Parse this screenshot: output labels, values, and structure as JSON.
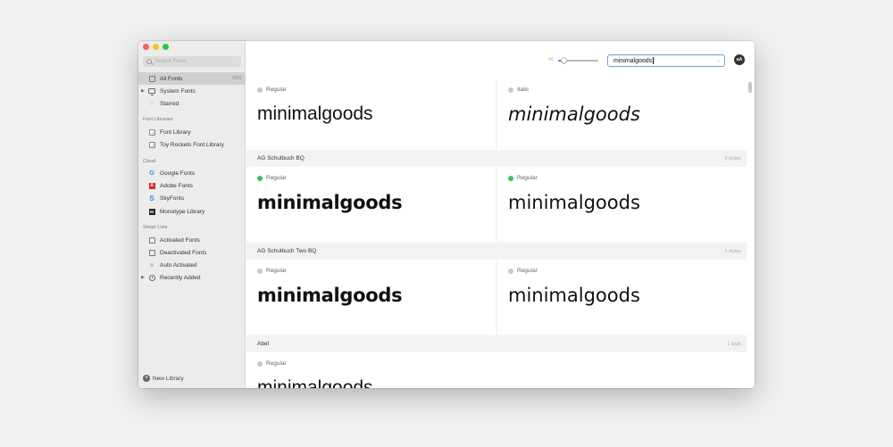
{
  "sidebar": {
    "search_placeholder": "Search Fonts",
    "top_items": [
      {
        "label": "All Fonts",
        "count": "3161",
        "icon": "font-file-icon",
        "selected": true
      },
      {
        "label": "System Fonts",
        "icon": "monitor-icon",
        "expandable": true
      },
      {
        "label": "Starred",
        "icon": "star-icon"
      }
    ],
    "sections": {
      "font_libraries": "Font Libraries",
      "cloud": "Cloud",
      "smart_lists": "Smart Lists"
    },
    "library_items": [
      {
        "label": "Font Library",
        "icon": "library-cube-icon"
      },
      {
        "label": "Toy Rockets Font Library",
        "icon": "library-cube-icon"
      }
    ],
    "cloud_items": [
      {
        "label": "Google Fonts",
        "icon": "google-icon"
      },
      {
        "label": "Adobe Fonts",
        "icon": "adobe-icon"
      },
      {
        "label": "SkyFonts",
        "icon": "skyfonts-icon"
      },
      {
        "label": "Monotype Library",
        "icon": "monotype-icon"
      }
    ],
    "smart_items": [
      {
        "label": "Activated Fonts",
        "icon": "smart-list-icon"
      },
      {
        "label": "Deactivated Fonts",
        "icon": "smart-list-icon"
      },
      {
        "label": "Auto Activated",
        "icon": "wifi-icon"
      },
      {
        "label": "Recently Added",
        "icon": "clock-icon",
        "expandable": true
      }
    ],
    "new_library": "New Library"
  },
  "toolbar": {
    "size_label": "40",
    "size_slider_fraction": 0.15,
    "preview_text": "minimalgoods",
    "aa_label": "aA"
  },
  "content": {
    "first_row": [
      {
        "style": "Regular",
        "active": false,
        "sample": "minimalgoods"
      },
      {
        "style": "Italic",
        "active": false,
        "sample": "minimalgoods"
      }
    ],
    "groups": [
      {
        "name": "AG Schulbuch BQ",
        "styles_count": "3 styles",
        "cards": [
          {
            "style": "Regular",
            "active": true,
            "sample": "minimalgoods"
          },
          {
            "style": "Regular",
            "active": true,
            "sample": "minimalgoods"
          }
        ]
      },
      {
        "name": "AG Schulbuch Two BQ",
        "styles_count": "2 styles",
        "cards": [
          {
            "style": "Regular",
            "active": false,
            "sample": "minimalgoods"
          },
          {
            "style": "Regular",
            "active": false,
            "sample": "minimalgoods"
          }
        ]
      },
      {
        "name": "Abel",
        "styles_count": "1 style",
        "cards": [
          {
            "style": "Regular",
            "active": false,
            "sample": "minimalgoods"
          }
        ]
      }
    ]
  },
  "colors": {
    "accent": "#3b86f6",
    "active_dot": "#3cc061",
    "sidebar_bg": "#ececec"
  }
}
